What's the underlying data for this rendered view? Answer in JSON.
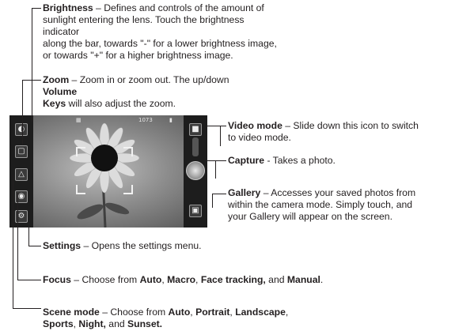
{
  "annotations": {
    "brightness": {
      "title": "Brightness",
      "lines": [
        " – Defines and controls of the amount of",
        "sunlight entering the lens. Touch the brightness indicator",
        "along the bar, towards \"-\" for a lower brightness image,",
        "or towards \"+\" for a higher brightness image."
      ]
    },
    "zoom": {
      "title": "Zoom",
      "line1_rest": " – Zoom in or zoom out. The up/down ",
      "volume": "Volume",
      "keys": "Keys",
      "line2_rest": " will also adjust the zoom."
    },
    "video_mode": {
      "title": "Video mode",
      "lines": [
        " – Slide down this icon to switch",
        "to video mode."
      ]
    },
    "capture": {
      "title": "Capture",
      "text": " - Takes a photo."
    },
    "gallery": {
      "title": "Gallery",
      "lines": [
        " – Accesses your saved photos from",
        "within the camera mode. Simply touch, and",
        "your Gallery will appear on the screen."
      ]
    },
    "settings": {
      "title": "Settings",
      "text": " – Opens the settings menu."
    },
    "focus": {
      "title": "Focus",
      "p1": " – Choose from ",
      "auto": "Auto",
      "sep1": ", ",
      "macro": "Macro",
      "sep2": ", ",
      "face": "Face tracking,",
      "sep3": " and ",
      "manual": "Manual",
      "end": "."
    },
    "scene": {
      "title": "Scene mode",
      "p1": " – Choose from ",
      "auto": "Auto",
      "sep1": ", ",
      "portrait": "Portrait",
      "sep2": ", ",
      "landscape": "Landscape",
      "end1": ",",
      "sports": "Sports",
      "sep3": ", ",
      "night": "Night,",
      "sep4": " and ",
      "sunset": "Sunset."
    }
  },
  "screen": {
    "counter": "1073",
    "left_icons": [
      "brightness-icon",
      "zoom-icon",
      "scene-mode-icon",
      "focus-icon",
      "settings-icon"
    ],
    "right_icons": [
      "camera-icon",
      "capture-icon",
      "gallery-icon"
    ]
  }
}
